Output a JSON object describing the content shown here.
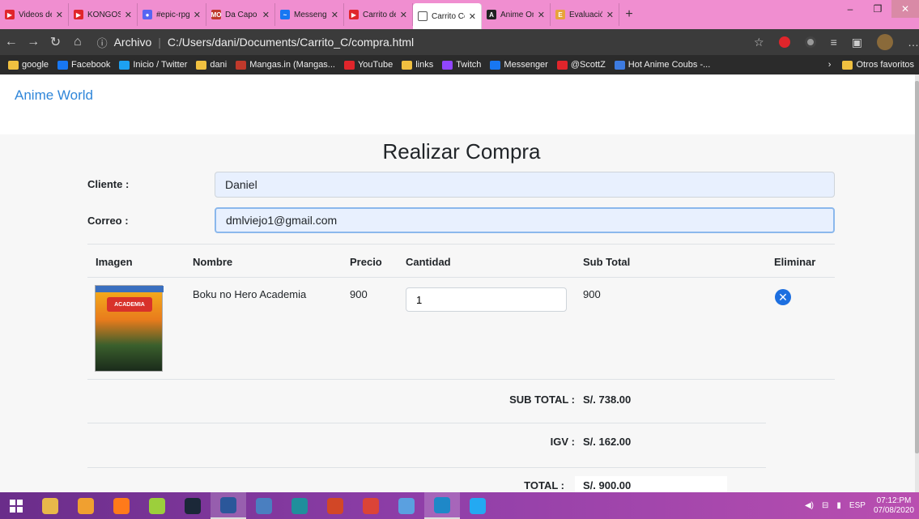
{
  "tabs": [
    {
      "label": "Videos del c",
      "favicon_color": "#e0252b",
      "favicon": "▶"
    },
    {
      "label": "KONGOS - C",
      "favicon_color": "#e0252b",
      "favicon": "▶"
    },
    {
      "label": "#epic-rpg",
      "favicon_color": "#5865f2",
      "favicon": "●"
    },
    {
      "label": "Da Capo Su",
      "favicon_color": "#c0392b",
      "favicon": "MO"
    },
    {
      "label": "Messenger",
      "favicon_color": "#1877f2",
      "favicon": "~"
    },
    {
      "label": "Carrito de C",
      "favicon_color": "#e0252b",
      "favicon": "▶"
    },
    {
      "label": "Carrito Com",
      "favicon_color": "#ffffff",
      "favicon": "",
      "active": true
    },
    {
      "label": "Anime Onlin",
      "favicon_color": "#222",
      "favicon": "A"
    },
    {
      "label": "Evaluación",
      "favicon_color": "#e8a33c",
      "favicon": "E"
    }
  ],
  "address": {
    "scheme_label": "Archivo",
    "url": "C:/Users/dani/Documents/Carrito_C/compra.html"
  },
  "bookmarks": [
    {
      "label": "google",
      "type": "folder"
    },
    {
      "label": "Facebook",
      "color": "#1877f2"
    },
    {
      "label": "Inicio / Twitter",
      "color": "#1da1f2"
    },
    {
      "label": "dani",
      "type": "folder"
    },
    {
      "label": "Mangas.in (Mangas...",
      "color": "#c0392b"
    },
    {
      "label": "YouTube",
      "color": "#e0252b"
    },
    {
      "label": "links",
      "type": "folder"
    },
    {
      "label": "Twitch",
      "color": "#9146ff"
    },
    {
      "label": "Messenger",
      "color": "#1877f2"
    },
    {
      "label": "@ScottZ",
      "color": "#e0252b"
    },
    {
      "label": "Hot Anime Coubs -...",
      "color": "#3d7be0"
    }
  ],
  "bookmarks_other": "Otros favoritos",
  "page": {
    "brand": "Anime World",
    "title": "Realizar Compra",
    "client_label": "Cliente :",
    "client_value": "Daniel",
    "email_label": "Correo :",
    "email_value": "dmlviejo1@gmail.com",
    "table": {
      "headers": [
        "Imagen",
        "Nombre",
        "Precio",
        "Cantidad",
        "Sub Total",
        "Eliminar"
      ],
      "rows": [
        {
          "name": "Boku no Hero Academia",
          "price": "900",
          "quantity": "1",
          "subtotal": "900"
        }
      ]
    },
    "totals": {
      "subtotal_label": "SUB TOTAL :",
      "subtotal_value": "S/. 738.00",
      "igv_label": "IGV :",
      "igv_value": "S/. 162.00",
      "total_label": "TOTAL :",
      "total_value": "S/. 900.00"
    }
  },
  "taskbar": {
    "apps": [
      "explorer",
      "rockstar",
      "firefox",
      "android",
      "steam",
      "word",
      "notepad",
      "arduino",
      "powerpoint",
      "chrome",
      "paint",
      "edge",
      "vscode"
    ],
    "lang": "ESP",
    "time": "07:12:PM",
    "date": "07/08/2020"
  }
}
